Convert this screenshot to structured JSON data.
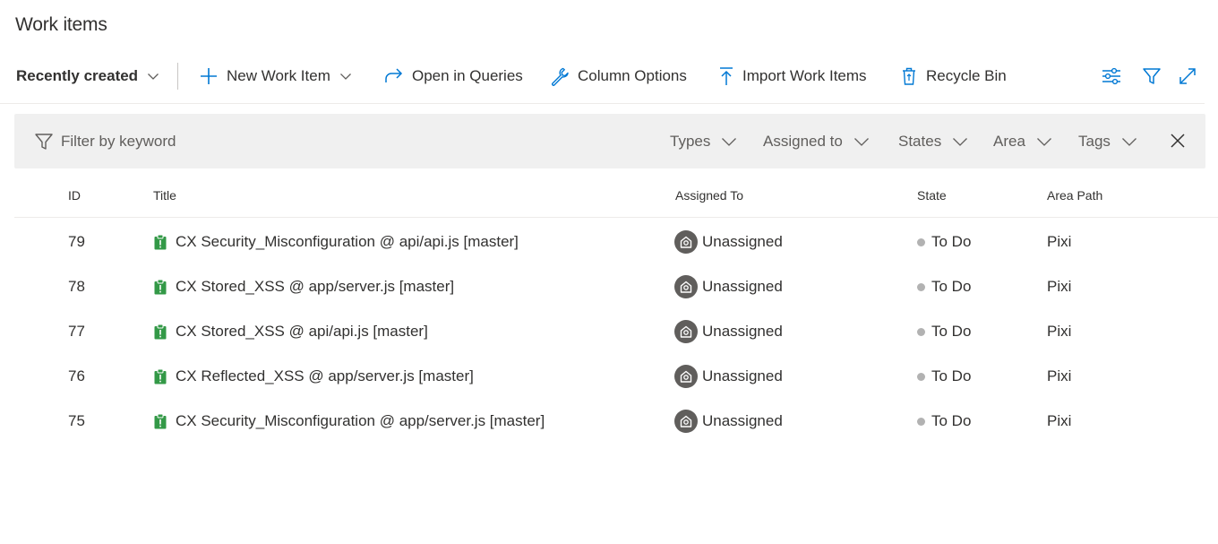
{
  "page": {
    "title": "Work items"
  },
  "toolbar": {
    "pivot": "Recently created",
    "new_work_item": "New Work Item",
    "open_in_queries": "Open in Queries",
    "column_options": "Column Options",
    "import_work_items": "Import Work Items",
    "recycle_bin": "Recycle Bin"
  },
  "filter": {
    "placeholder": "Filter by keyword",
    "types": "Types",
    "assigned_to": "Assigned to",
    "states": "States",
    "area": "Area",
    "tags": "Tags"
  },
  "grid": {
    "columns": [
      "ID",
      "Title",
      "Assigned To",
      "State",
      "Area Path"
    ],
    "rows": [
      {
        "id": "79",
        "title": "CX Security_Misconfiguration @ api/api.js [master]",
        "assigned_to": "Unassigned",
        "state": "To Do",
        "area": "Pixi"
      },
      {
        "id": "78",
        "title": "CX Stored_XSS @ app/server.js [master]",
        "assigned_to": "Unassigned",
        "state": "To Do",
        "area": "Pixi"
      },
      {
        "id": "77",
        "title": "CX Stored_XSS @ api/api.js [master]",
        "assigned_to": "Unassigned",
        "state": "To Do",
        "area": "Pixi"
      },
      {
        "id": "76",
        "title": "CX Reflected_XSS @ app/server.js [master]",
        "assigned_to": "Unassigned",
        "state": "To Do",
        "area": "Pixi"
      },
      {
        "id": "75",
        "title": "CX Security_Misconfiguration @ app/server.js [master]",
        "assigned_to": "Unassigned",
        "state": "To Do",
        "area": "Pixi"
      }
    ]
  },
  "colors": {
    "accent": "#0078d4",
    "work_item_icon": "#339947",
    "state_dot": "#b2b2b2",
    "filter_bar_bg": "#f0f0f0"
  }
}
